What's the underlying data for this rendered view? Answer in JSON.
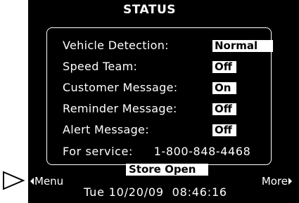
{
  "screen": {
    "title": "STATUS",
    "rows": [
      {
        "label": "Vehicle Detection:",
        "value": "Normal"
      },
      {
        "label": "Speed Team:",
        "value": "Off"
      },
      {
        "label": "Customer Message:",
        "value": "On"
      },
      {
        "label": "Reminder Message:",
        "value": "Off"
      },
      {
        "label": "Alert Message:",
        "value": "Off"
      }
    ],
    "service_label": "For service:",
    "service_phone": "1-800-848-4468",
    "store_status": "Store Open",
    "menu_label": "Menu",
    "more_label": "More",
    "datetime": "Tue 10/20/09  08:46:16"
  },
  "colors": {
    "background": "#000000",
    "text": "#ffffff",
    "highlight": "#ffffff"
  }
}
